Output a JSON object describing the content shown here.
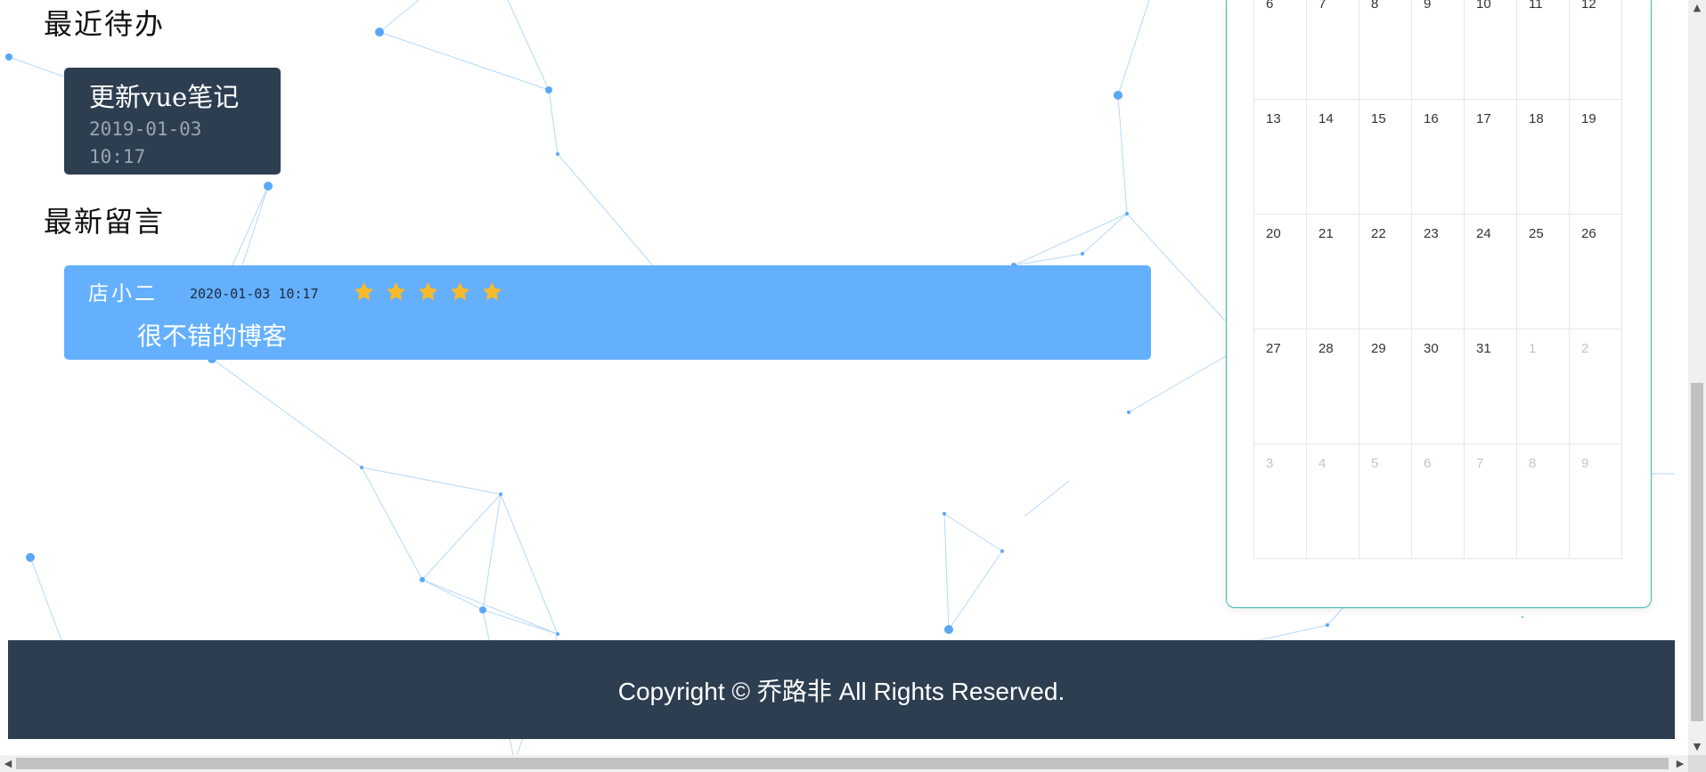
{
  "todo": {
    "section_title": "最近待办",
    "items": [
      {
        "title": "更新vue笔记",
        "date": "2019-01-03",
        "time": "10:17"
      }
    ]
  },
  "messages": {
    "section_title": "最新留言",
    "items": [
      {
        "author": "店小二",
        "timestamp": "2020-01-03 10:17",
        "rating": 5,
        "content": "很不错的博客"
      }
    ]
  },
  "calendar": {
    "weeks": [
      [
        {
          "d": "6",
          "other": false
        },
        {
          "d": "7",
          "other": false
        },
        {
          "d": "8",
          "other": false
        },
        {
          "d": "9",
          "other": false
        },
        {
          "d": "10",
          "other": false
        },
        {
          "d": "11",
          "other": false
        },
        {
          "d": "12",
          "other": false
        }
      ],
      [
        {
          "d": "13",
          "other": false
        },
        {
          "d": "14",
          "other": false
        },
        {
          "d": "15",
          "other": false
        },
        {
          "d": "16",
          "other": false
        },
        {
          "d": "17",
          "other": false
        },
        {
          "d": "18",
          "other": false
        },
        {
          "d": "19",
          "other": false
        }
      ],
      [
        {
          "d": "20",
          "other": false
        },
        {
          "d": "21",
          "other": false
        },
        {
          "d": "22",
          "other": false
        },
        {
          "d": "23",
          "other": false
        },
        {
          "d": "24",
          "other": false
        },
        {
          "d": "25",
          "other": false
        },
        {
          "d": "26",
          "other": false
        }
      ],
      [
        {
          "d": "27",
          "other": false
        },
        {
          "d": "28",
          "other": false
        },
        {
          "d": "29",
          "other": false
        },
        {
          "d": "30",
          "other": false
        },
        {
          "d": "31",
          "other": false
        },
        {
          "d": "1",
          "other": true
        },
        {
          "d": "2",
          "other": true
        }
      ],
      [
        {
          "d": "3",
          "other": true
        },
        {
          "d": "4",
          "other": true
        },
        {
          "d": "5",
          "other": true
        },
        {
          "d": "6",
          "other": true
        },
        {
          "d": "7",
          "other": true
        },
        {
          "d": "8",
          "other": true
        },
        {
          "d": "9",
          "other": true
        }
      ]
    ]
  },
  "footer": {
    "copyright": "Copyright © 乔路非 All Rights Reserved."
  },
  "colors": {
    "footer_bg": "#2c3e50",
    "todo_card_bg": "#2d3e50",
    "message_card_bg": "#64b0ff",
    "star": "#f7ba2a",
    "calendar_border": "#3cb9a8",
    "particle": "#5aa8f5"
  },
  "icons": {
    "rating_star": "star-icon",
    "scroll_up": "scroll-up-arrow-icon",
    "scroll_down": "scroll-down-arrow-icon",
    "scroll_left": "scroll-left-arrow-icon",
    "scroll_right": "scroll-right-arrow-icon"
  }
}
